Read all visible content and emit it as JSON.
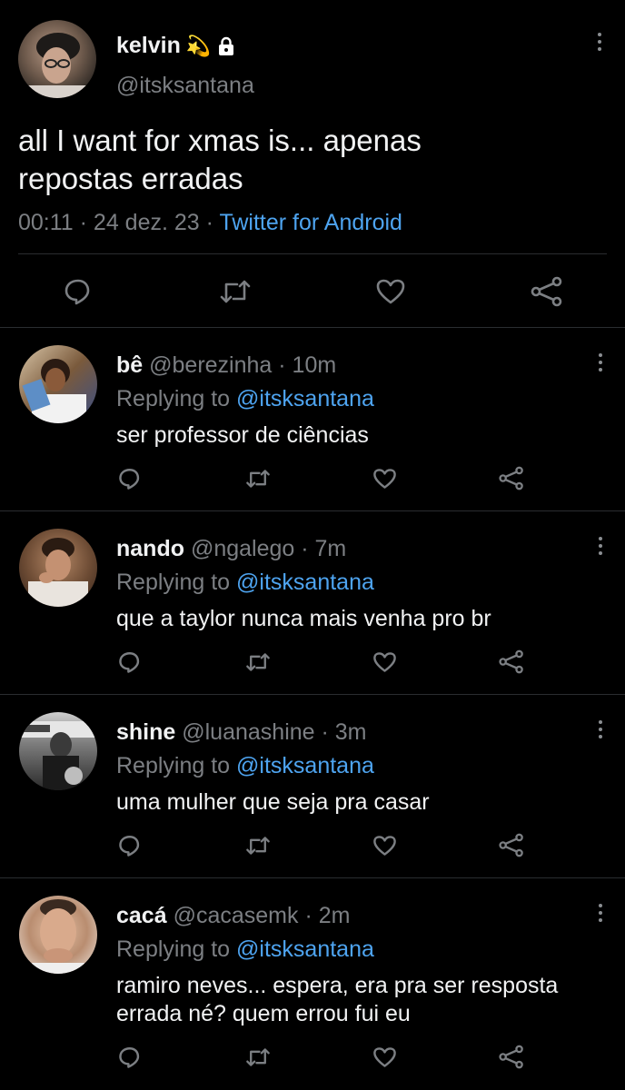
{
  "tweet": {
    "display_name": "kelvin",
    "name_emoji": "💫",
    "handle": "@itsksantana",
    "text_line1": "all I want for xmas is... apenas",
    "text_line2": "repostas erradas",
    "time_date": "00:11 · 24 dez. 23 ·",
    "source": "Twitter for Android"
  },
  "replies": [
    {
      "name": "bê",
      "meta": "@berezinha · 10m",
      "replying_prefix": "Replying to",
      "replying_handle": "@itsksantana",
      "text_lines": [
        "ser professor de ciências"
      ]
    },
    {
      "name": "nando",
      "meta": "@ngalego · 7m",
      "replying_prefix": "Replying to",
      "replying_handle": "@itsksantana",
      "text_lines": [
        "que a taylor nunca mais venha pro br"
      ]
    },
    {
      "name": "shine",
      "meta": "@luanashine · 3m",
      "replying_prefix": "Replying to",
      "replying_handle": "@itsksantana",
      "text_lines": [
        "uma mulher que seja pra casar"
      ]
    },
    {
      "name": "cacá",
      "meta": "@cacasemk · 2m",
      "replying_prefix": "Replying to",
      "replying_handle": "@itsksantana",
      "text_lines": [
        "ramiro neves... espera, era pra ser resposta",
        "errada né? quem errou fui eu"
      ]
    }
  ],
  "icons": {
    "reply": "reply-icon",
    "retweet": "retweet-icon",
    "like": "heart-icon",
    "share": "share-icon",
    "more": "more-options-icon",
    "lock": "lock-icon"
  },
  "colors": {
    "background": "#000000",
    "text": "#e7e9ea",
    "muted": "#7c7f83",
    "link": "#4ea4f0",
    "divider": "#2a2d30"
  }
}
